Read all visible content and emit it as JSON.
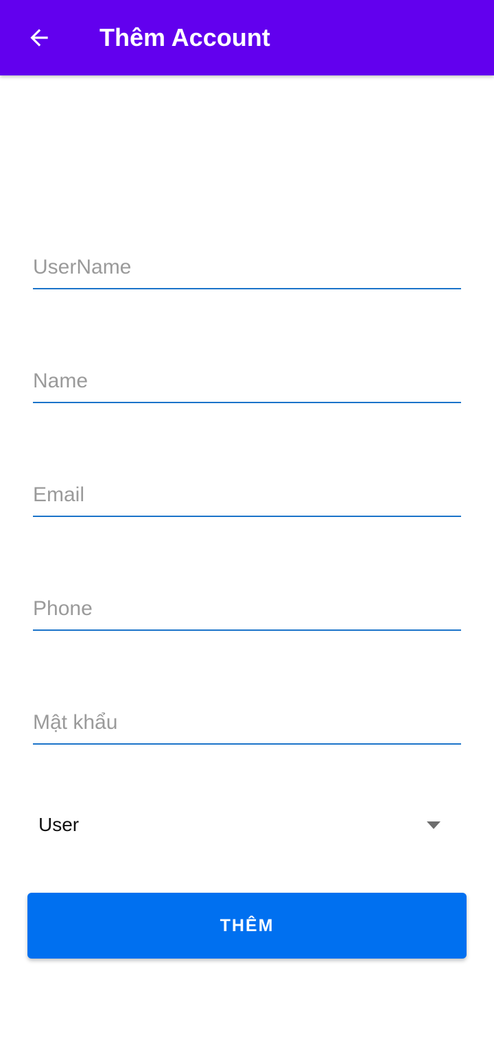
{
  "app_bar": {
    "title": "Thêm Account",
    "back_icon": "arrow-left-icon",
    "background_color": "#6200ee"
  },
  "form": {
    "fields": [
      {
        "id": "username",
        "placeholder": "UserName",
        "value": ""
      },
      {
        "id": "name",
        "placeholder": "Name",
        "value": ""
      },
      {
        "id": "email",
        "placeholder": "Email",
        "value": ""
      },
      {
        "id": "phone",
        "placeholder": "Phone",
        "value": ""
      },
      {
        "id": "password",
        "placeholder": "Mật khẩu",
        "value": ""
      }
    ],
    "underline_color": "#1a73c9",
    "role_select": {
      "selected": "User",
      "icon": "dropdown-arrow-icon"
    },
    "submit_label": "THÊM",
    "submit_color": "#0070f0"
  }
}
